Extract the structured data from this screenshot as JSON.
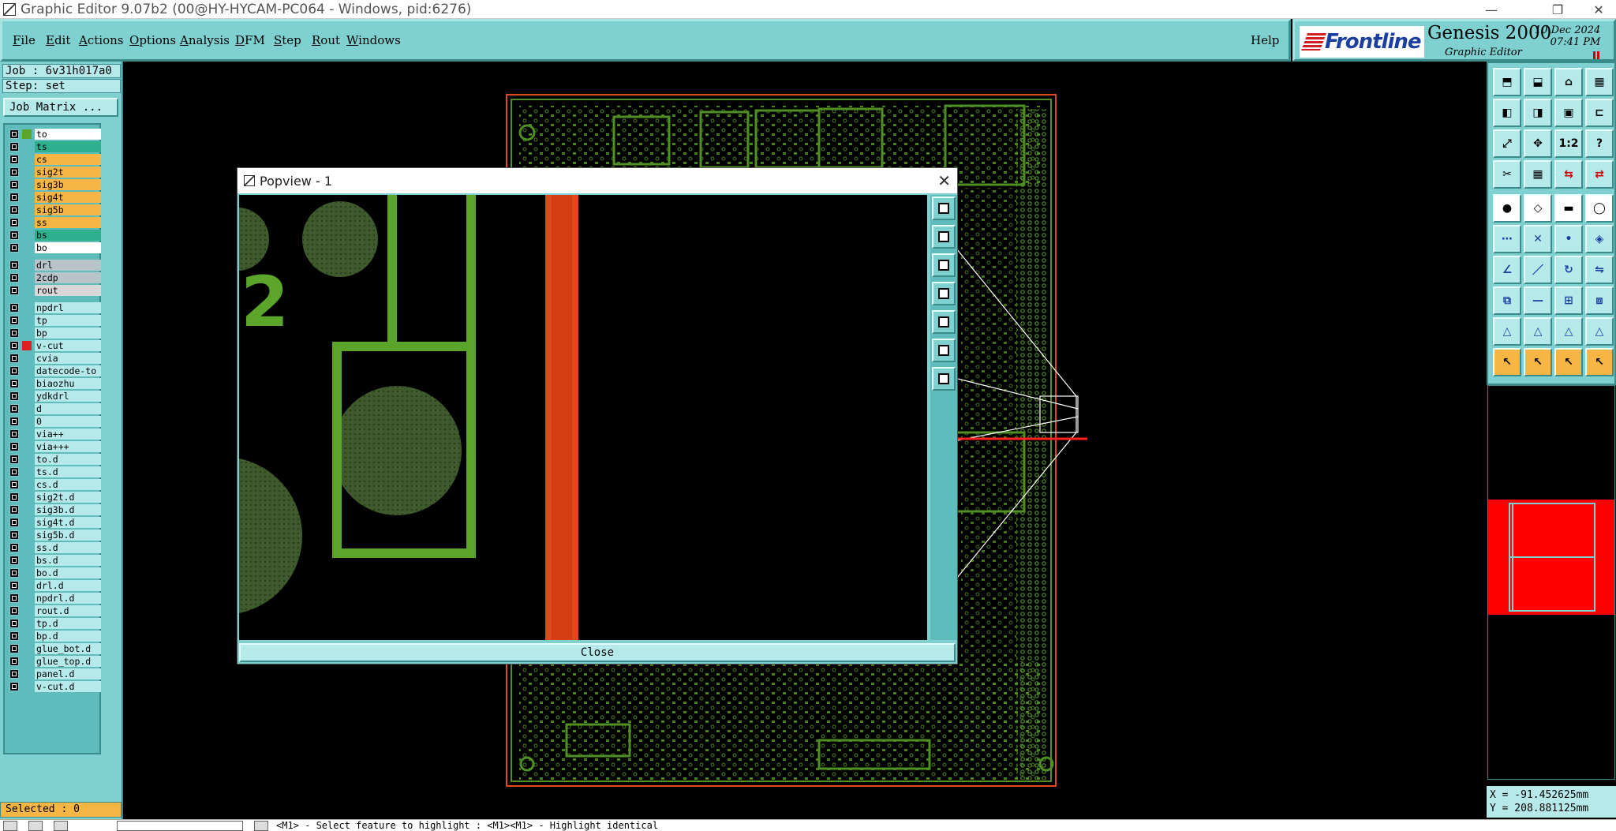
{
  "window": {
    "title": "Graphic Editor 9.07b2 (00@HY-HYCAM-PC064 - Windows, pid:6276)",
    "minimize": "—",
    "restore": "❐",
    "close": "✕"
  },
  "menu": {
    "items": [
      {
        "key": "F",
        "rest": "ile"
      },
      {
        "key": "E",
        "rest": "dit"
      },
      {
        "key": "A",
        "rest": "ctions"
      },
      {
        "key": "O",
        "rest": "ptions"
      },
      {
        "key": "A",
        "rest": "nalysis"
      },
      {
        "key": "D",
        "rest": "FM"
      },
      {
        "key": "S",
        "rest": "tep"
      },
      {
        "key": "R",
        "rest": "out"
      },
      {
        "key": "W",
        "rest": "indows"
      }
    ],
    "help": "Help"
  },
  "brand": {
    "frontline": "Frontline",
    "product": "Genesis 2000",
    "subtitle": "Graphic Editor",
    "date": "10 Dec 2024",
    "time": "07:41 PM"
  },
  "job": {
    "job_label": "Job : 6v31h017a0",
    "step_label": "Step: set",
    "matrix_button": "Job Matrix ..."
  },
  "layers": [
    {
      "name": "to",
      "bg": "#ffffff",
      "color": "#5ba52a"
    },
    {
      "name": "ts",
      "bg": "#2fb08f",
      "color": ""
    },
    {
      "name": "cs",
      "bg": "#f7b544",
      "color": ""
    },
    {
      "name": "sig2t",
      "bg": "#f7b544",
      "color": ""
    },
    {
      "name": "sig3b",
      "bg": "#f7b544",
      "color": ""
    },
    {
      "name": "sig4t",
      "bg": "#f7b544",
      "color": ""
    },
    {
      "name": "sig5b",
      "bg": "#f7b544",
      "color": ""
    },
    {
      "name": "ss",
      "bg": "#f7b544",
      "color": ""
    },
    {
      "name": "bs",
      "bg": "#2fb08f",
      "color": ""
    },
    {
      "name": "bo",
      "bg": "#ffffff",
      "color": ""
    },
    {
      "name": "drl",
      "bg": "#b8c4c8",
      "color": ""
    },
    {
      "name": "2cdp",
      "bg": "#b8c4c8",
      "color": ""
    },
    {
      "name": "rout",
      "bg": "#d8d8d8",
      "color": ""
    },
    {
      "name": "npdrl",
      "bg": "#b6eaea",
      "color": ""
    },
    {
      "name": "tp",
      "bg": "#b6eaea",
      "color": ""
    },
    {
      "name": "bp",
      "bg": "#b6eaea",
      "color": ""
    },
    {
      "name": "v-cut",
      "bg": "#b6eaea",
      "color": "#e02020"
    },
    {
      "name": "cvia",
      "bg": "#b6eaea",
      "color": ""
    },
    {
      "name": "datecode-to",
      "bg": "#b6eaea",
      "color": ""
    },
    {
      "name": "biaozhu",
      "bg": "#b6eaea",
      "color": ""
    },
    {
      "name": "ydkdrl",
      "bg": "#b6eaea",
      "color": ""
    },
    {
      "name": "d",
      "bg": "#b6eaea",
      "color": ""
    },
    {
      "name": "0",
      "bg": "#b6eaea",
      "color": ""
    },
    {
      "name": "via++",
      "bg": "#b6eaea",
      "color": ""
    },
    {
      "name": "via+++",
      "bg": "#b6eaea",
      "color": ""
    },
    {
      "name": "to.d",
      "bg": "#b6eaea",
      "color": ""
    },
    {
      "name": "ts.d",
      "bg": "#b6eaea",
      "color": ""
    },
    {
      "name": "cs.d",
      "bg": "#b6eaea",
      "color": ""
    },
    {
      "name": "sig2t.d",
      "bg": "#b6eaea",
      "color": ""
    },
    {
      "name": "sig3b.d",
      "bg": "#b6eaea",
      "color": ""
    },
    {
      "name": "sig4t.d",
      "bg": "#b6eaea",
      "color": ""
    },
    {
      "name": "sig5b.d",
      "bg": "#b6eaea",
      "color": ""
    },
    {
      "name": "ss.d",
      "bg": "#b6eaea",
      "color": ""
    },
    {
      "name": "bs.d",
      "bg": "#b6eaea",
      "color": ""
    },
    {
      "name": "bo.d",
      "bg": "#b6eaea",
      "color": ""
    },
    {
      "name": "drl.d",
      "bg": "#b6eaea",
      "color": ""
    },
    {
      "name": "npdrl.d",
      "bg": "#b6eaea",
      "color": ""
    },
    {
      "name": "rout.d",
      "bg": "#b6eaea",
      "color": ""
    },
    {
      "name": "tp.d",
      "bg": "#b6eaea",
      "color": ""
    },
    {
      "name": "bp.d",
      "bg": "#b6eaea",
      "color": ""
    },
    {
      "name": "glue_bot.d",
      "bg": "#b6eaea",
      "color": ""
    },
    {
      "name": "glue_top.d",
      "bg": "#b6eaea",
      "color": ""
    },
    {
      "name": "panel.d",
      "bg": "#b6eaea",
      "color": ""
    },
    {
      "name": "v-cut.d",
      "bg": "#b6eaea",
      "color": ""
    }
  ],
  "selected": "Selected : 0",
  "status_message": "<M1> - Select feature to highlight : <M1><M1> - Highlight identical",
  "coords": {
    "x": "X = -91.452625mm",
    "y": "Y = 208.881125mm"
  },
  "popview": {
    "title": "Popview - 1",
    "close_label": "Close",
    "digit": "2"
  },
  "colors": {
    "panel": "#7fd0d0",
    "copper": "#5ba52a",
    "vcut": "#e04a1a",
    "highlight": "#ff0000"
  },
  "toolbar_icons": [
    "zoom-home-icon",
    "zoom-in-icon",
    "house-icon",
    "grid-icon",
    "pan-left-icon",
    "pan-right-icon",
    "zoom-window-icon",
    "snap-icon",
    "fit-icon",
    "center-icon",
    "scale-1-2-icon",
    "help-question-icon",
    "tweezers-icon",
    "layer-grid-icon",
    "measure-icon",
    "measure-alt-icon",
    "drill-icon",
    "eraser-icon",
    "ruler-icon",
    "circle-icon",
    "node-icon",
    "cross-icon",
    "point-icon",
    "connect-icon",
    "angle-icon",
    "slash-icon",
    "rotate-icon",
    "mirror-icon",
    "copy-icon",
    "line-icon",
    "square-icon",
    "stack-icon",
    "triangle-icon",
    "triangle-a-icon",
    "triangle-b-icon",
    "triangle-c-icon",
    "pointer-icon",
    "pointer-box-icon",
    "pointer-alt-icon",
    "pointer-multi-icon"
  ]
}
